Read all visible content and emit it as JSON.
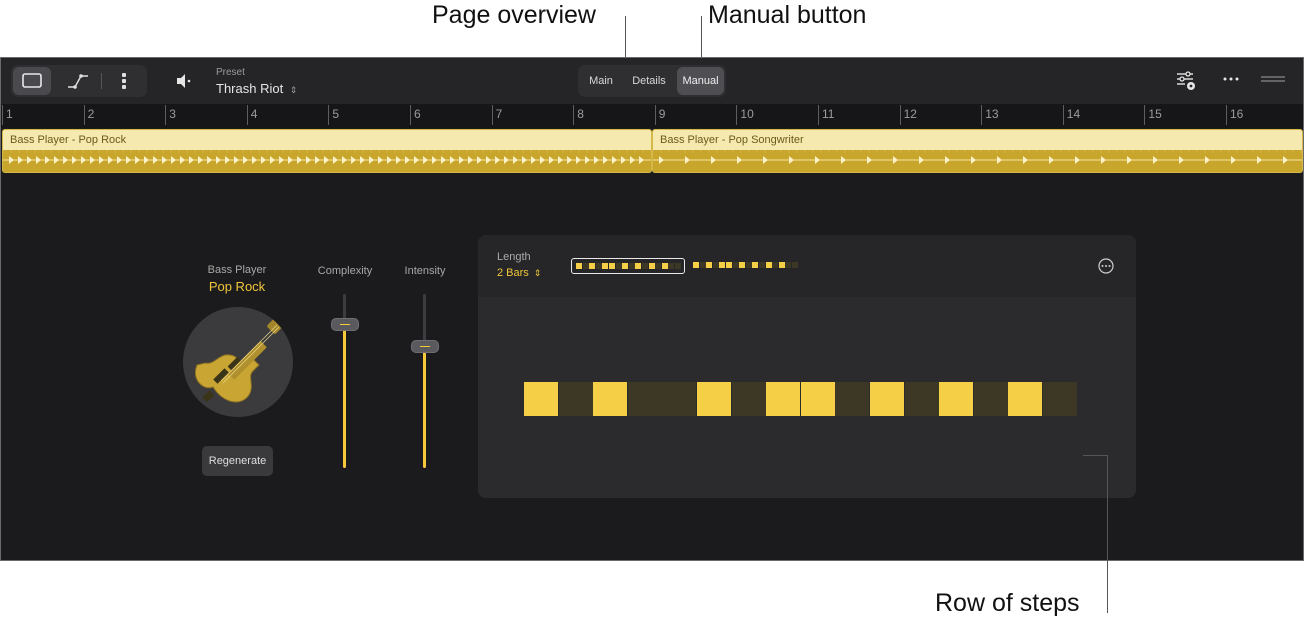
{
  "annotations": {
    "page_overview": "Page overview",
    "manual_button": "Manual button",
    "row_of_steps": "Row of steps"
  },
  "toolbar": {
    "view_buttons": [
      {
        "icon": "single-pane-icon",
        "active": true
      },
      {
        "icon": "automation-curve-icon",
        "active": false
      },
      {
        "icon": "vertical-dots-icon",
        "active": false
      }
    ],
    "speaker_icon": "speaker-icon",
    "preset_label": "Preset",
    "preset_value": "Thrash Riot",
    "tabs": [
      {
        "label": "Main",
        "active": false
      },
      {
        "label": "Details",
        "active": false
      },
      {
        "label": "Manual",
        "active": true
      }
    ],
    "right_icons": [
      "mixer-settings-icon",
      "more-icon",
      "drag-handle-icon"
    ]
  },
  "ruler": {
    "bars": [
      "1",
      "2",
      "3",
      "4",
      "5",
      "6",
      "7",
      "8",
      "9",
      "10",
      "11",
      "12",
      "13",
      "14",
      "15",
      "16"
    ]
  },
  "regions": [
    {
      "name": "Bass Player - Pop Rock"
    },
    {
      "name": "Bass Player - Pop Songwriter"
    }
  ],
  "player": {
    "label": "Bass Player",
    "style": "Pop Rock",
    "regenerate_label": "Regenerate"
  },
  "sliders": [
    {
      "label": "Complexity",
      "value": 0.83
    },
    {
      "label": "Intensity",
      "value": 0.7
    }
  ],
  "step_editor": {
    "length_label": "Length",
    "length_value": "2 Bars",
    "overview_pages": [
      {
        "active": true,
        "cells": [
          1,
          0,
          1,
          0,
          1,
          1,
          0,
          1,
          0,
          1,
          0,
          1,
          0,
          1,
          0,
          0
        ]
      },
      {
        "active": false,
        "cells": [
          1,
          0,
          1,
          0,
          1,
          1,
          0,
          1,
          0,
          1,
          0,
          1,
          0,
          1,
          0,
          0
        ]
      }
    ],
    "steps": [
      1,
      0,
      1,
      0,
      0,
      1,
      0,
      1,
      1,
      0,
      1,
      0,
      1,
      0,
      1,
      0
    ]
  },
  "colors": {
    "accent": "#f4c93a",
    "step_on": "#f5cf45",
    "step_off": "#3d3826",
    "region": "#c8a52b"
  }
}
